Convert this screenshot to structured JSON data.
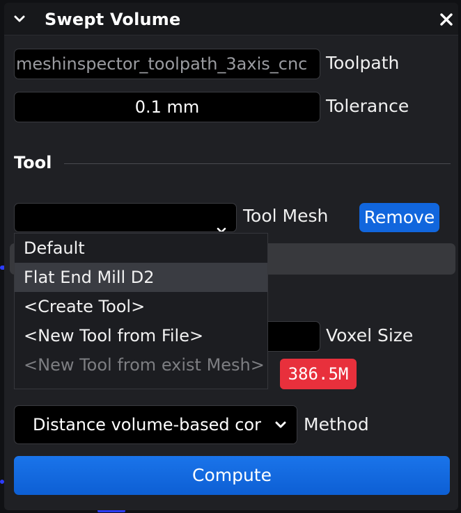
{
  "window": {
    "title": "Swept Volume",
    "collapse_icon": "chevron-down-icon",
    "close_icon": "close-icon"
  },
  "toolpath": {
    "value": "meshinspector_toolpath_3axis_cnc",
    "label": "Toolpath"
  },
  "tolerance": {
    "value": "0.1 mm",
    "label": "Tolerance"
  },
  "tool_section": {
    "title": "Tool"
  },
  "tool_mesh": {
    "value": "",
    "label": "Tool Mesh",
    "remove_label": "Remove",
    "options": [
      {
        "label": "Default",
        "selected": false,
        "disabled": false
      },
      {
        "label": "Flat End Mill D2",
        "selected": true,
        "disabled": false
      },
      {
        "label": "<Create Tool>",
        "selected": false,
        "disabled": false
      },
      {
        "label": "<New Tool from File>",
        "selected": false,
        "disabled": false
      },
      {
        "label": "<New Tool from exist Mesh>",
        "selected": false,
        "disabled": true
      }
    ]
  },
  "voxel": {
    "value": "",
    "label": "Voxel Size",
    "memory_badge": "386.5M"
  },
  "method": {
    "value": "Distance volume-based cor",
    "label": "Method"
  },
  "compute_label": "Compute",
  "colors": {
    "accent": "#1166dd",
    "badge_red": "#e8303c",
    "panel_bg": "#1f2024",
    "scene_line": "#2c3cff"
  }
}
